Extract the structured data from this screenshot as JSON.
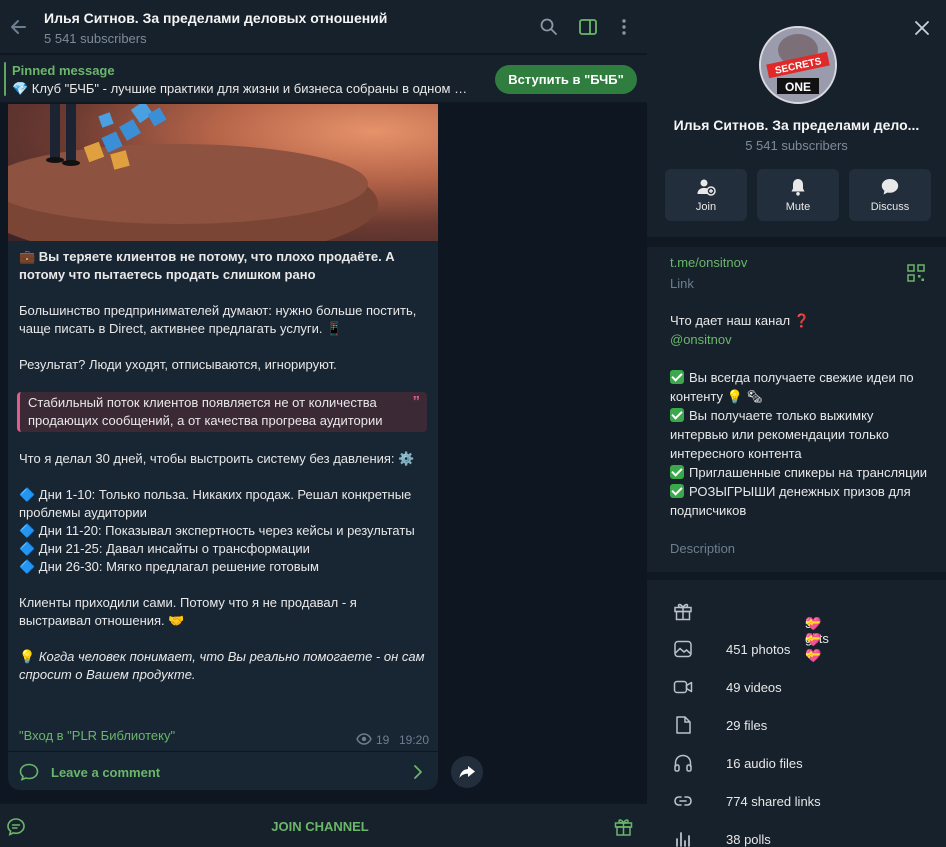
{
  "chat": {
    "title": "Илья Ситнов. За пределами деловых отношений",
    "subtitle": "5 541 subscribers",
    "pinned": {
      "label": "Pinned message",
      "text": "💎 Клуб \"БЧБ\" - лучшие практики для жизни и бизнеса собраны в одном …",
      "button": "Вступить в \"БЧБ\""
    },
    "message": {
      "headline": "💼 Вы теряете клиентов не потому, что плохо продаёте. А потому что пытаетесь продать слишком рано",
      "p1": "Большинство предпринимателей думают: нужно больше постить, чаще писать в Direct, активнее предлагать услуги. 📱",
      "p2": "Результат? Люди уходят, отписываются, игнорируют.",
      "quote": "Стабильный поток клиентов появляется не от количества продающих сообщений, а от качества прогрева аудитории",
      "p3": "Что я делал 30 дней, чтобы выстроить систему без давления: ⚙️",
      "list": [
        "🔷 Дни 1-10: Только польза. Никаких продаж. Решал конкретные проблемы аудитории",
        "🔷 Дни 11-20: Показывал экспертность через кейсы и результаты",
        "🔷 Дни 21-25: Давал инсайты о трансформации",
        "🔷 Дни 26-30: Мягко предлагал решение готовым"
      ],
      "p4": "Клиенты приходили сами. Потому что я не продавал - я выстраивал отношения. 🤝",
      "p5_icon": "💡",
      "p5": "Когда человек понимает, что Вы реально помогаете - он сам спросит о Вашем продукте.",
      "link": "\"Вход в \"PLR Библиотеку\"",
      "views": "19",
      "time": "19:20",
      "comment": "Leave a comment"
    },
    "join_channel": "JOIN CHANNEL"
  },
  "panel": {
    "name": "Илья Ситнов. За пределами дело...",
    "subscribers": "5 541 subscribers",
    "avatar_text_top": "SECRETS",
    "avatar_text_bottom": "ONE",
    "actions": [
      "Join",
      "Mute",
      "Discuss"
    ],
    "link_value": "t.me/onsitnov",
    "link_label": "Link",
    "desc_line1": "Что дает наш канал ❓",
    "desc_handle": "@onsitnov",
    "desc_items": [
      "Вы всегда получаете свежие идеи по контенту 💡 🗞",
      "Вы получаете только выжимку интервью или рекомендации только интересного контента",
      "Приглашенные спикеры на трансляции",
      "РОЗЫГРЫШИ денежных призов для подписчиков"
    ],
    "desc_label": "Description",
    "stats": {
      "gifts": "5 gifts",
      "gifts_icons": "💝💝💝",
      "photos": "451 photos",
      "videos": "49 videos",
      "files": "29 files",
      "audio": "16 audio files",
      "links": "774 shared links",
      "polls": "38 polls"
    }
  },
  "colors": {
    "accent": "#6ab66a",
    "bg": "#0e1621",
    "panel": "#17212b",
    "bubble": "#182533"
  }
}
